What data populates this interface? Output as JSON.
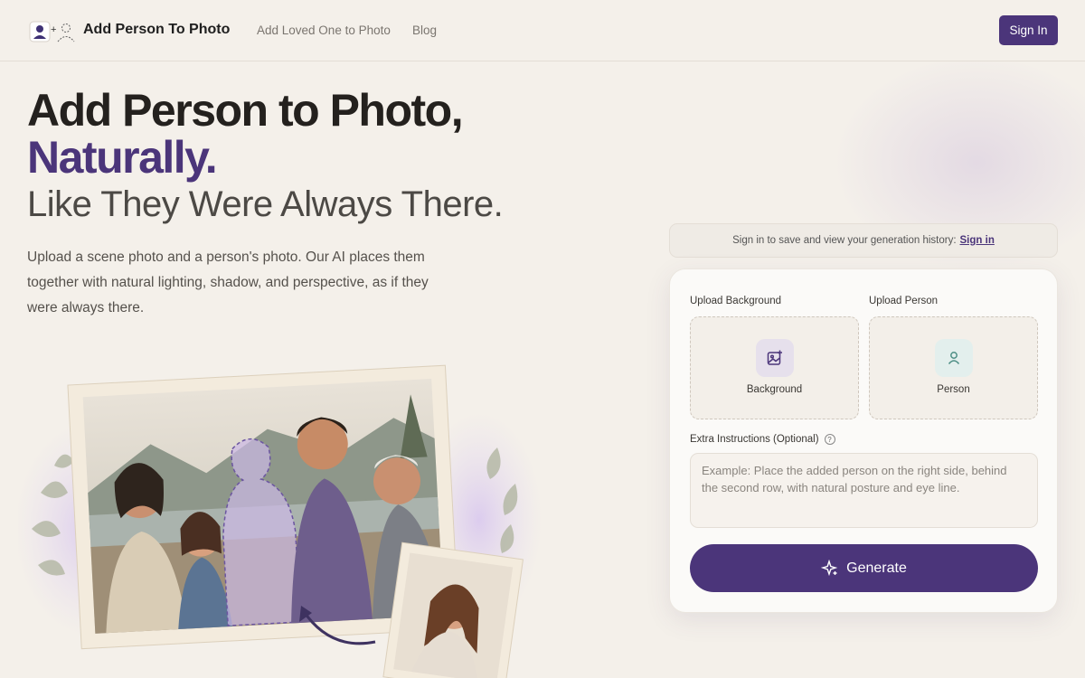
{
  "header": {
    "brand": "Add Person To Photo",
    "nav": [
      {
        "label": "Add Loved One to Photo"
      },
      {
        "label": "Blog"
      }
    ],
    "sign_in": "Sign In"
  },
  "hero": {
    "title_line1": "Add Person to Photo,",
    "title_line2": "Naturally.",
    "subtitle": "Like They Were Always There.",
    "description": "Upload a scene photo and a person's photo. Our AI places them together with natural lighting, shadow, and perspective, as if they were always there."
  },
  "history_bar": {
    "text": "Sign in to save and view your generation history:",
    "link": "Sign in"
  },
  "form": {
    "background_label": "Upload Background",
    "background_drop": "Background",
    "person_label": "Upload Person",
    "person_drop": "Person",
    "extra_label": "Extra Instructions (Optional)",
    "extra_placeholder": "Example: Place the added person on the right side, behind the second row, with natural posture and eye line.",
    "generate": "Generate"
  },
  "colors": {
    "accent": "#4b357a",
    "background": "#f4f0ea"
  },
  "icons": [
    "person-plus-logo-icon",
    "image-plus-icon",
    "person-icon",
    "help-icon",
    "sparkle-icon"
  ]
}
